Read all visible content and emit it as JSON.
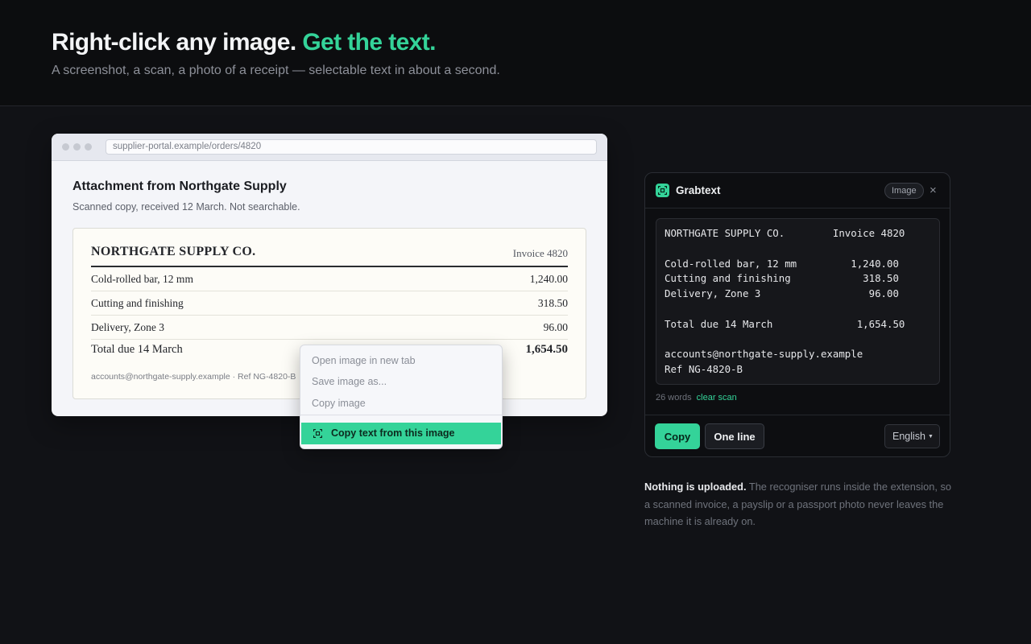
{
  "hero": {
    "title_main": "Right-click any image.",
    "title_accent": "Get the text.",
    "subtitle": "A screenshot, a scan, a photo of a receipt — selectable text in about a second."
  },
  "browser": {
    "url": "supplier-portal.example/orders/4820",
    "page_title": "Attachment from Northgate Supply",
    "page_subtitle": "Scanned copy, received 12 March. Not searchable."
  },
  "invoice": {
    "company": "NORTHGATE SUPPLY CO.",
    "number": "Invoice 4820",
    "lines": [
      {
        "label": "Cold-rolled bar, 12 mm",
        "value": "1,240.00"
      },
      {
        "label": "Cutting and finishing",
        "value": "318.50"
      },
      {
        "label": "Delivery, Zone 3",
        "value": "96.00"
      }
    ],
    "total_label": "Total due 14 March",
    "total_value": "1,654.50",
    "footer": "accounts@northgate-supply.example  ·  Ref NG-4820-B"
  },
  "context_menu": {
    "items": [
      "Open image in new tab",
      "Save image as...",
      "Copy image"
    ],
    "active_item": "Copy text from this image"
  },
  "panel": {
    "app_name": "Grabtext",
    "badge": "Image",
    "close_glyph": "×",
    "ocr_text": "NORTHGATE SUPPLY CO.        Invoice 4820\n\nCold-rolled bar, 12 mm         1,240.00\nCutting and finishing            318.50\nDelivery, Zone 3                  96.00\n\nTotal due 14 March              1,654.50\n\naccounts@northgate-supply.example\nRef NG-4820-B",
    "word_count": "26 words",
    "clear_link": "clear scan",
    "copy_label": "Copy",
    "one_line_label": "One line",
    "language": "English"
  },
  "note": {
    "lead": "Nothing is uploaded.",
    "body": " The recogniser runs inside the extension, so a scanned invoice, a payslip or a passport photo never leaves the machine it is already on."
  },
  "colors": {
    "accent": "#34d399",
    "background": "#111216"
  }
}
